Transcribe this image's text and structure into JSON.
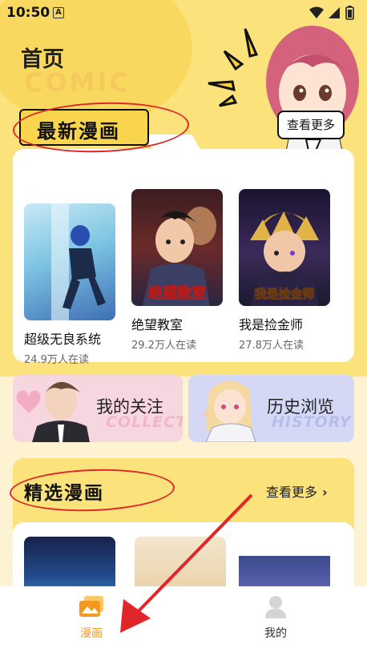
{
  "status_bar": {
    "time": "10:50",
    "notif_glyph": "A"
  },
  "header": {
    "title": "首页",
    "watermark": "COMIC"
  },
  "latest": {
    "title": "最新漫画",
    "more": "查看更多",
    "comics": [
      {
        "title": "超级无良系统",
        "reads": "24.9万人在读",
        "cover_text": ""
      },
      {
        "title": "绝望教室",
        "reads": "29.2万人在读",
        "cover_text": "绝望教室"
      },
      {
        "title": "我是捡金师",
        "reads": "27.8万人在读",
        "cover_text": "我是捡金师"
      }
    ]
  },
  "quick": {
    "collect": {
      "label": "我的关注",
      "watermark": "COLLECT"
    },
    "history": {
      "label": "历史浏览",
      "watermark": "HISTORY"
    }
  },
  "featured": {
    "title": "精选漫画",
    "more": "查看更多"
  },
  "tabbar": {
    "manga": "漫画",
    "mine": "我的"
  },
  "colors": {
    "accent": "#f39a1e",
    "highlight_ring": "#e0262a",
    "yellow": "#fbe27a"
  }
}
